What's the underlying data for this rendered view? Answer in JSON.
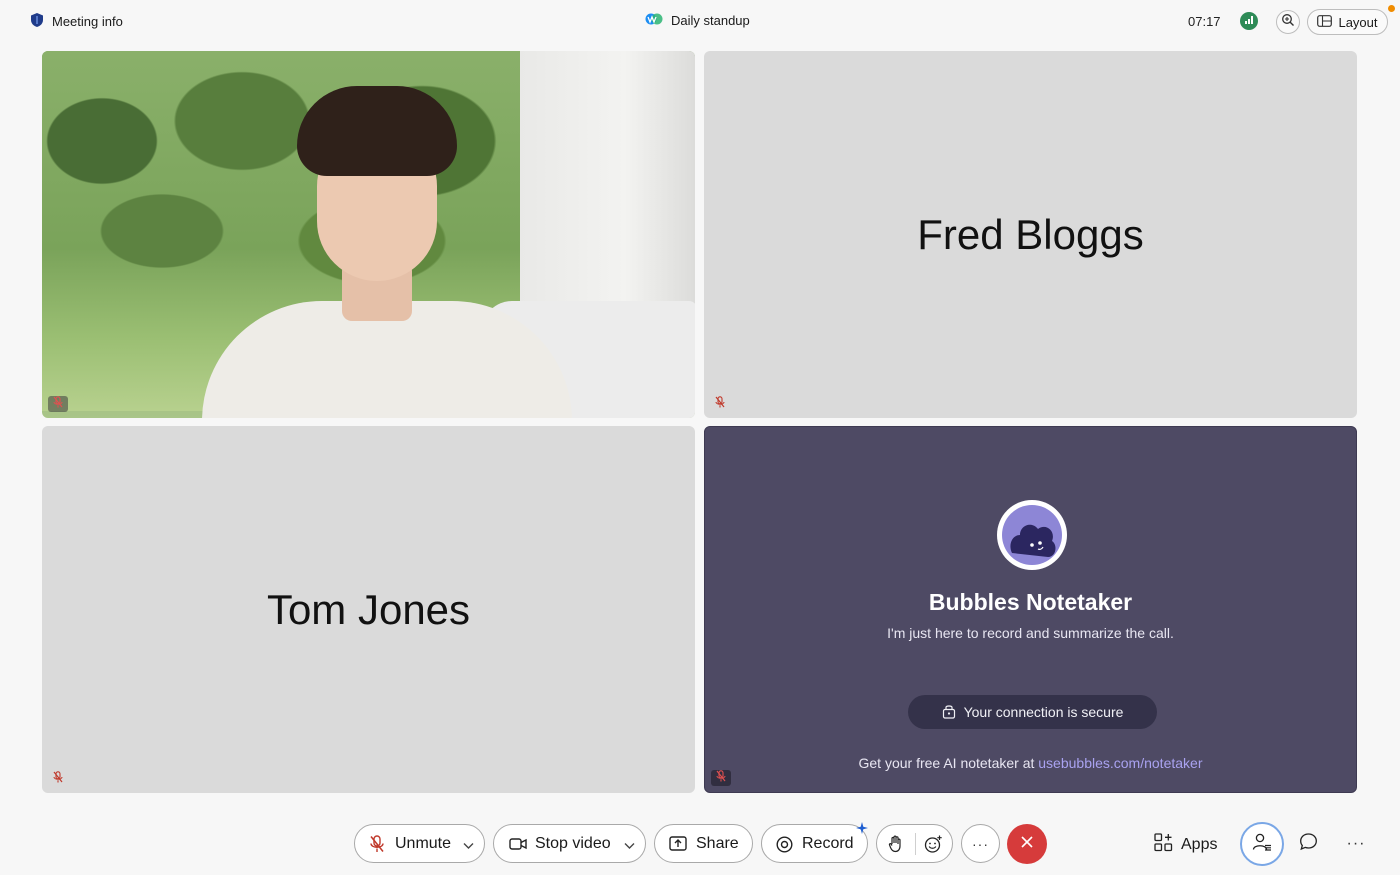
{
  "topbar": {
    "meeting_info_label": "Meeting info",
    "meeting_title": "Daily standup",
    "clock": "07:17",
    "layout_label": "Layout"
  },
  "tiles": {
    "top_right_name": "Fred Bloggs",
    "bottom_left_name": "Tom Jones",
    "bot": {
      "title": "Bubbles Notetaker",
      "subtitle": "I'm just here to record and summarize the call.",
      "secure_label": "Your connection is secure",
      "footer_text": "Get your free AI notetaker at ",
      "footer_link": "usebubbles.com/notetaker"
    }
  },
  "toolbar": {
    "unmute_label": "Unmute",
    "stop_video_label": "Stop video",
    "share_label": "Share",
    "record_label": "Record",
    "more_label": "···",
    "apps_label": "Apps",
    "more_right_label": "···"
  },
  "colors": {
    "end_call": "#d63b3b",
    "bot_tile": "#4e4a64",
    "link": "#a9a2f0",
    "mute_red": "#c0392b"
  },
  "icons": [
    "shield-icon",
    "webex-icon",
    "stats-icon",
    "zoom-icon",
    "layout-icon",
    "mic-muted-icon",
    "camera-icon",
    "share-icon",
    "record-icon",
    "sparkle-icon",
    "raise-hand-icon",
    "reactions-icon",
    "more-icon",
    "close-icon",
    "apps-icon",
    "participants-icon",
    "chat-icon",
    "lock-icon"
  ]
}
